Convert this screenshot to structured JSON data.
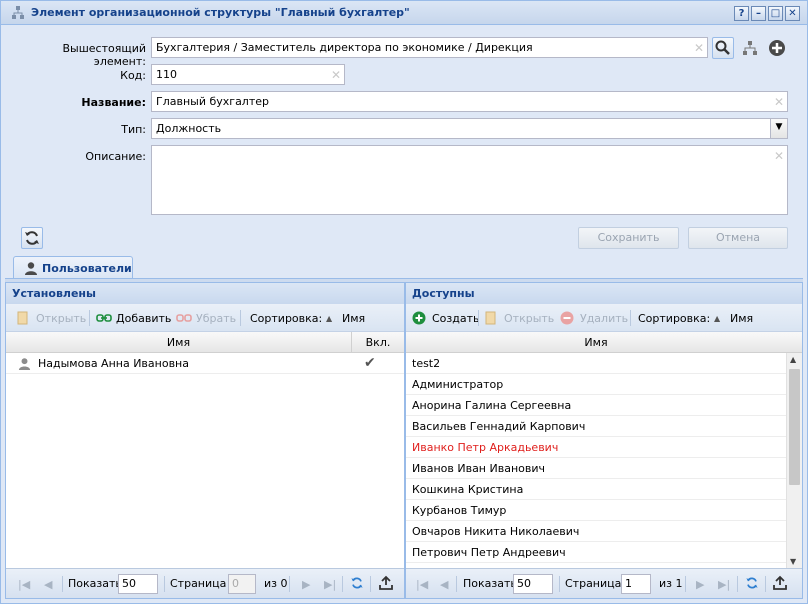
{
  "window": {
    "title": "Элемент организационной структуры \"Главный бухгалтер\""
  },
  "form": {
    "parent_label": "Вышестоящий элемент:",
    "parent_value": "Бухгалтерия / Заместитель директора по экономике / Дирекция",
    "code_label": "Код:",
    "code_value": "110",
    "name_label": "Название:",
    "name_value": "Главный бухгалтер",
    "type_label": "Тип:",
    "type_value": "Должность",
    "desc_label": "Описание:",
    "desc_value": "",
    "save_label": "Сохранить",
    "cancel_label": "Отмена"
  },
  "tab": {
    "label": "Пользователи"
  },
  "installed": {
    "title": "Установлены",
    "open": "Открыть",
    "add": "Добавить",
    "remove": "Убрать",
    "sort_label": "Сортировка:",
    "sort_field": "Имя",
    "col_name": "Имя",
    "col_incl": "Вкл.",
    "rows": [
      {
        "name": "Надымова Анна Ивановна",
        "checked": "✔"
      }
    ],
    "pager": {
      "show_label": "Показать",
      "page_size": "50",
      "page_label": "Страница",
      "page": "0",
      "of": "из 0"
    }
  },
  "available": {
    "title": "Доступны",
    "create": "Создать",
    "open": "Открыть",
    "delete": "Удалить",
    "sort_label": "Сортировка:",
    "sort_field": "Имя",
    "col_name": "Имя",
    "rows": [
      "test2",
      "Администратор",
      "Анорина Галина Сергеевна",
      "Васильев Геннадий Карпович",
      "Иванко Петр Аркадьевич",
      "Иванов Иван Иванович",
      "Кошкина Кристина",
      "Курбанов Тимур",
      "Овчаров Никита Николаевич",
      "Петрович Петр Андреевич"
    ],
    "highlight_row": "Иванко Петр Аркадьевич",
    "highlight_color": "#e0201d",
    "pager": {
      "show_label": "Показать",
      "page_size": "50",
      "page_label": "Страница",
      "page": "1",
      "of": "из 1"
    }
  },
  "colors": {
    "header_text": "#15428b",
    "border": "#99bbe8",
    "add_green": "#1e8e3e"
  }
}
